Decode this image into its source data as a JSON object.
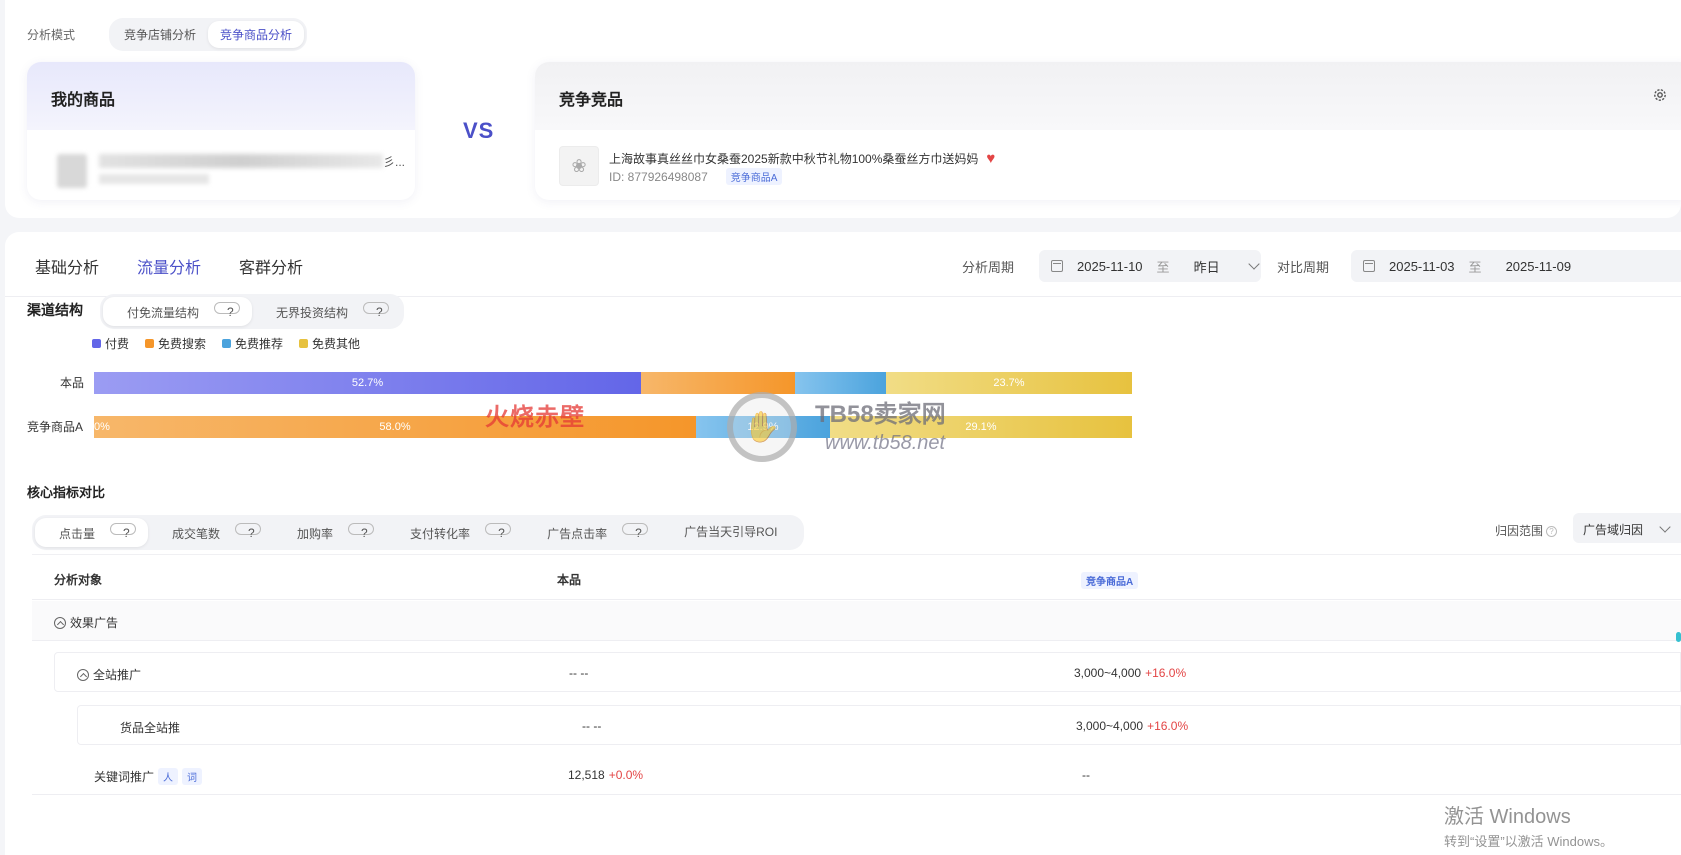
{
  "mode": {
    "label": "分析模式",
    "options": [
      "竞争店铺分析",
      "竞争商品分析"
    ],
    "active": 1
  },
  "my_product": {
    "title": "我的商品",
    "name_tail": "彡..."
  },
  "vs": "VS",
  "competitor": {
    "title": "竞争竞品",
    "product_name": "上海故事真丝丝巾女桑蚕2025新款中秋节礼物100%桑蚕丝方巾送妈妈",
    "product_id": "ID: 877926498087",
    "tag": "竞争商品A"
  },
  "tabs": [
    {
      "label": "基础分析",
      "active": false
    },
    {
      "label": "流量分析",
      "active": true
    },
    {
      "label": "客群分析",
      "active": false
    }
  ],
  "period": {
    "label": "分析周期",
    "start": "2025-11-10",
    "sep": "至",
    "end": "昨日"
  },
  "compare_period": {
    "label": "对比周期",
    "start": "2025-11-03",
    "sep": "至",
    "end": "2025-11-09"
  },
  "channel": {
    "title": "渠道结构",
    "options": [
      "付免流量结构",
      "无界投资结构"
    ],
    "legend": [
      {
        "name": "付费",
        "color": "#6366e8"
      },
      {
        "name": "免费搜索",
        "color": "#f5962a"
      },
      {
        "name": "免费推荐",
        "color": "#4ba3dd"
      },
      {
        "name": "免费其他",
        "color": "#e7c23f"
      }
    ]
  },
  "chart_data": {
    "type": "bar",
    "stacked": "100%",
    "categories": [
      "本品",
      "竞争商品A"
    ],
    "series": [
      {
        "name": "付费",
        "values": [
          52.7,
          0
        ],
        "labels": [
          "52.7%",
          "0%"
        ]
      },
      {
        "name": "免费搜索",
        "values": [
          14.8,
          58.0
        ],
        "labels": [
          "",
          "58.0%"
        ]
      },
      {
        "name": "免费推荐",
        "values": [
          8.8,
          12.9
        ],
        "labels": [
          "",
          "12.9%"
        ]
      },
      {
        "name": "免费其他",
        "values": [
          23.7,
          29.1
        ],
        "labels": [
          "23.7%",
          "29.1%"
        ]
      }
    ]
  },
  "watermark": {
    "red": "火烧赤壁",
    "site": "TB58卖家网",
    "url": "www.tb58.net"
  },
  "core": {
    "title": "核心指标对比",
    "metrics": [
      "点击量",
      "成交笔数",
      "加购率",
      "支付转化率",
      "广告点击率",
      "广告当天引导ROI"
    ],
    "active": 0,
    "attr_label": "归因范围",
    "attr_value": "广告域归因"
  },
  "table": {
    "headers": {
      "object": "分析对象",
      "mine": "本品",
      "comp": "竞争商品A"
    },
    "rows": [
      {
        "name": "效果广告",
        "mine": "",
        "comp": "",
        "comp_delta": ""
      },
      {
        "name": "全站推广",
        "mine": "-- --",
        "comp": "3,000~4,000",
        "comp_delta": "+16.0%"
      },
      {
        "name": "货品全站推",
        "mine": "-- --",
        "comp": "3,000~4,000",
        "comp_delta": "+16.0%"
      },
      {
        "name": "关键词推广",
        "tag1": "人",
        "tag2": "词",
        "mine": "12,518",
        "mine_delta": "+0.0%",
        "comp": "--"
      }
    ]
  },
  "windows": {
    "line1": "激活 Windows",
    "line2": "转到“设置”以激活 Windows。"
  }
}
